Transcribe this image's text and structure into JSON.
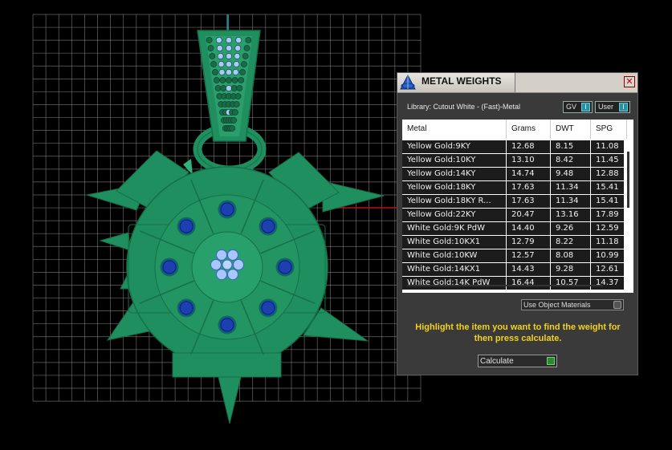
{
  "panel": {
    "title": "METAL WEIGHTS",
    "close_glyph": "✕",
    "library_label": "Library: Cutout White - (Fast)-Metal",
    "toggles": [
      {
        "label": "GV",
        "state_glyph": "I"
      },
      {
        "label": "User",
        "state_glyph": "I"
      }
    ],
    "table": {
      "columns": [
        "Metal",
        "Grams",
        "DWT",
        "SPG"
      ],
      "rows": [
        [
          "Yellow Gold:9KY",
          "12.68",
          "8.15",
          "11.08"
        ],
        [
          "Yellow Gold:10KY",
          "13.10",
          "8.42",
          "11.45"
        ],
        [
          "Yellow Gold:14KY",
          "14.74",
          "9.48",
          "12.88"
        ],
        [
          "Yellow Gold:18KY",
          "17.63",
          "11.34",
          "15.41"
        ],
        [
          "Yellow Gold:18KY R...",
          "17.63",
          "11.34",
          "15.41"
        ],
        [
          "Yellow Gold:22KY",
          "20.47",
          "13.16",
          "17.89"
        ],
        [
          "White Gold:9K PdW",
          "14.40",
          "9.26",
          "12.59"
        ],
        [
          "White Gold:10KX1",
          "12.79",
          "8.22",
          "11.18"
        ],
        [
          "White Gold:10KW",
          "12.57",
          "8.08",
          "10.99"
        ],
        [
          "White Gold:14KX1",
          "14.43",
          "9.28",
          "12.61"
        ],
        [
          "White Gold:14K PdW",
          "16.44",
          "10.57",
          "14.37"
        ]
      ]
    },
    "object_materials_label": "Use Object Materials",
    "instruction": "Highlight the item you want to find the weight for then press calculate.",
    "calculate_label": "Calculate"
  },
  "colors": {
    "background": "#000000",
    "grid": "#8a8a8a",
    "model_green": "#1f8f5f",
    "stone_blue": "#1d3fb0",
    "instruction_yellow": "#f2d21a"
  }
}
